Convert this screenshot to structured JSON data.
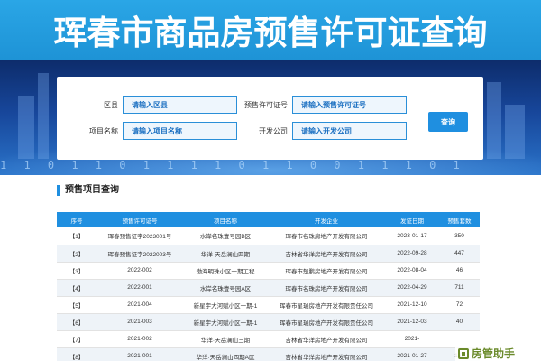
{
  "banner": {
    "title": "珲春市商品房预售许可证查询"
  },
  "hero": {
    "binary_text": "1 1 0 1 1 0 1 1 1 1 0 1 1 0 0 1 1 1 0 1"
  },
  "search": {
    "district_label": "区县",
    "district_placeholder": "请输入区县",
    "permit_label": "预售许可证号",
    "permit_placeholder": "请输入预售许可证号",
    "project_label": "项目名称",
    "project_placeholder": "请输入项目名称",
    "developer_label": "开发公司",
    "developer_placeholder": "请输入开发公司",
    "query_label": "查询"
  },
  "section": {
    "title": "预售项目查询"
  },
  "table": {
    "headers": [
      "序号",
      "预售许可证号",
      "项目名称",
      "开发企业",
      "发证日期",
      "预售套数"
    ],
    "rows": [
      [
        "【1】",
        "珲春预售证字2023001号",
        "水岸名珠壹号园B区",
        "珲春市名珠房地产开发有限公司",
        "2023-01-17",
        "350"
      ],
      [
        "【2】",
        "珲春预售证字2022003号",
        "华洋·天岳澜山四期",
        "吉林省华洋房地产开发有限公司",
        "2022-09-28",
        "447"
      ],
      [
        "【3】",
        "2022-002",
        "渤海明珠小区一期工程",
        "珲春市楚鹏房地产开发有限公司",
        "2022-08-04",
        "46"
      ],
      [
        "【4】",
        "2022-001",
        "水岸名珠壹号园A区",
        "珲春市名珠房地产开发有限公司",
        "2022-04-29",
        "711"
      ],
      [
        "【5】",
        "2021-004",
        "新星宇大河赋小区一期-1",
        "珲春市星瑞房地产开发有限责任公司",
        "2021-12-10",
        "72"
      ],
      [
        "【6】",
        "2021-003",
        "新星宇大河赋小区一期-1",
        "珲春市星瑞房地产开发有限责任公司",
        "2021-12-03",
        "40"
      ],
      [
        "【7】",
        "2021-002",
        "华洋·天岳澜山三期",
        "吉林省华洋房地产开发有限公司",
        "2021-",
        ""
      ],
      [
        "【8】",
        "2021-001",
        "华洋·天岳澜山四期A区",
        "吉林省华洋房地产开发有限公司",
        "2021-01-27",
        "167"
      ]
    ]
  },
  "watermark": {
    "text": "房管助手",
    "color": "#6a8a2a"
  },
  "colors": {
    "accent": "#1f8fe0",
    "banner": "#2aa6e6",
    "hero_dark": "#0d2c6b"
  }
}
